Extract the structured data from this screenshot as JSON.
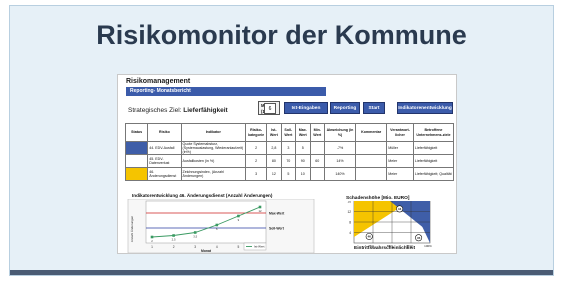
{
  "slide": {
    "title": "Risikomonitor der Kommune"
  },
  "header": {
    "title": "Risikomanagement",
    "subtitle": "Reporting- Monatsbericht"
  },
  "goal": {
    "label": "Strategisches Ziel:",
    "value": "Lieferfähigkeit"
  },
  "month": {
    "label": "Monat (1-12)",
    "value": "6"
  },
  "buttons": {
    "ist_eingaben": "Ist-Eingaben",
    "reporting": "Reporting",
    "start": "Start",
    "indikatorenentwicklung": "Indikatorenentwicklung"
  },
  "table": {
    "headers": [
      "Status",
      "Risiko",
      "Indikator",
      "Risiko-kategorie",
      "Ist-Wert",
      "Soll-Wert",
      "Max. Wert",
      "Min. Wert",
      "Abweichung (in %)",
      "Kommentar",
      "Verantwort-licher",
      "Betroffene Unternehmens-ziele"
    ],
    "rows": [
      {
        "status_color": "#3f5ea8",
        "risiko": "44. EDV-Ausfall",
        "indikator": "Quote Systemabsturz, (Systemauslastung, Wiederanlaufzeit) (in%)",
        "kategorie": "2",
        "ist": "2,8",
        "soll": "3",
        "max": "5",
        "min": "",
        "abw": "-7%",
        "kommentar": "",
        "verantw": "Müller",
        "ziele": "Lieferfähigkeit"
      },
      {
        "status_color": "#ffffff",
        "risiko": "45. EDV-Datenverlust",
        "indikator": "Ausfallkosten (in %)",
        "kategorie": "2",
        "ist": "80",
        "soll": "70",
        "max": "90",
        "min": "60",
        "abw": "14%",
        "kommentar": "",
        "verantw": "Meier",
        "ziele": "Lieferfähigkeit"
      },
      {
        "status_color": "#f5c400",
        "risiko": "46. Änderungsdienst",
        "indikator": "Zeichnungsindex, (Anzahl Änderungen)",
        "kategorie": "3",
        "ist": "12",
        "soll": "5",
        "max": "10",
        "min": "",
        "abw": "140%",
        "kommentar": "",
        "verantw": "Meier",
        "ziele": "Lieferfähigkeit; Qualität"
      }
    ]
  },
  "chart_data": [
    {
      "type": "line",
      "title": "Indikatorentwicklung 46. Änderungsdienst (Anzahl Änderungen)",
      "xlabel": "Monat",
      "ylabel": "Anzahl Änderungen",
      "categories": [
        "1",
        "2",
        "3",
        "4",
        "5",
        "6"
      ],
      "series": [
        {
          "name": "Ist-Wert",
          "values": [
            2,
            2.5,
            3.5,
            6,
            9,
            12
          ]
        }
      ],
      "reference_lines": [
        {
          "label": "Max-Wert",
          "value": 10,
          "color": "#cc2222"
        },
        {
          "label": "Soll-Wert",
          "value": 5,
          "color": "#2a3ba0"
        }
      ],
      "ylim": [
        0,
        14
      ]
    },
    {
      "type": "scatter",
      "title": "Schadenshöhe [Mio. EURO]",
      "xlabel": "Eintrittswahrscheinlichkeit",
      "x_ticks": [
        "25%",
        "50%",
        "75%",
        "100%"
      ],
      "y_ticks": [
        "4",
        "8",
        "12",
        "16"
      ],
      "points": [
        {
          "label": "44",
          "x": 0.6,
          "y": 13
        },
        {
          "label": "46",
          "x": 0.2,
          "y": 2.5
        },
        {
          "label": "45",
          "x": 0.85,
          "y": 2
        }
      ],
      "zones": [
        {
          "color": "#f5c400"
        },
        {
          "color": "#3f5ea8"
        }
      ]
    }
  ]
}
